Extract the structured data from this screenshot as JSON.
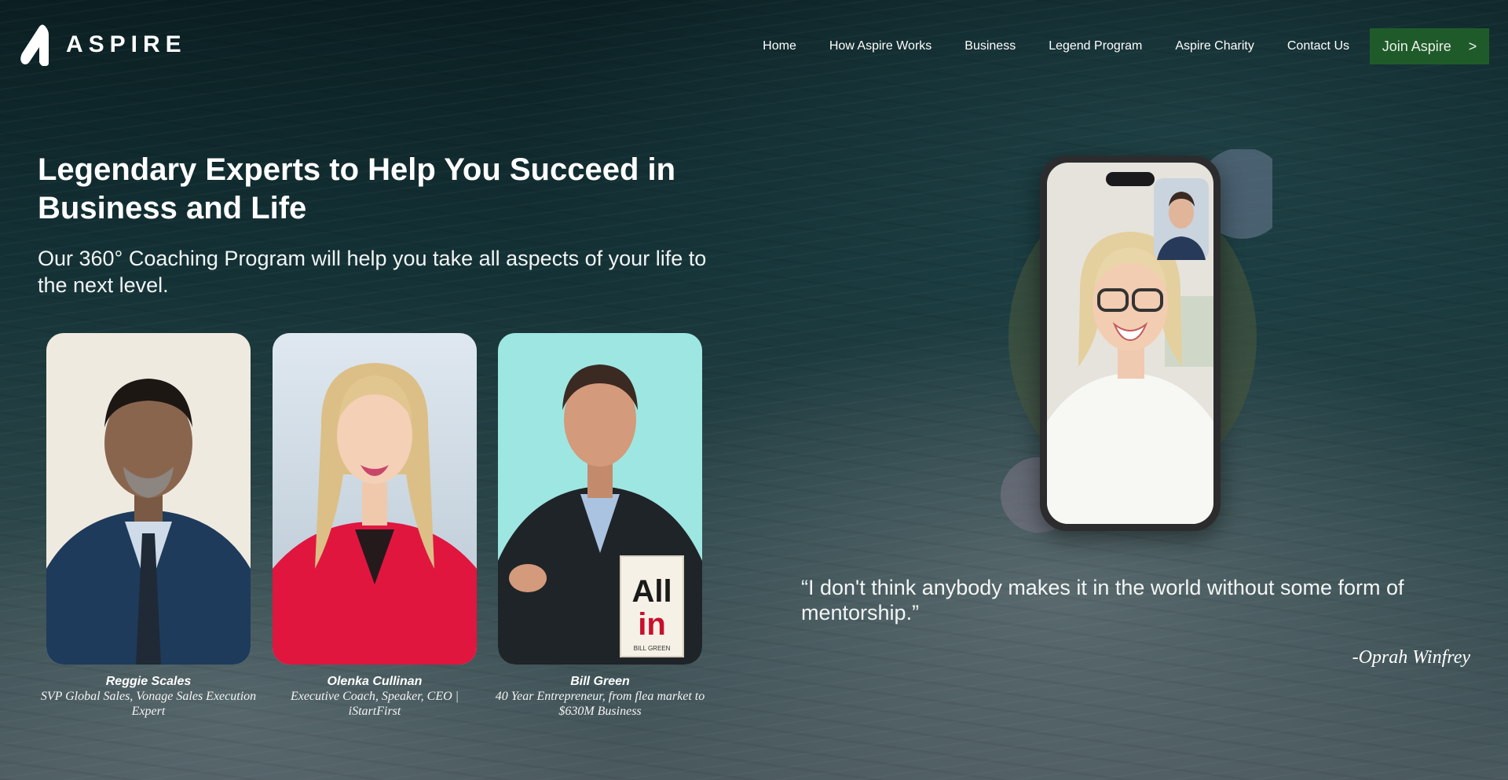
{
  "header": {
    "logo_text": "ASPIRE",
    "nav": [
      "Home",
      "How Aspire Works",
      "Business",
      "Legend Program",
      "Aspire Charity",
      "Contact Us"
    ],
    "cta_label": "Join Aspire",
    "cta_arrow": ">"
  },
  "hero": {
    "title": "Legendary Experts to Help You Succeed in Business and Life",
    "subtitle": "Our 360° Coaching Program will help you take all aspects of your life to the next level."
  },
  "experts": [
    {
      "name": "Reggie Scales",
      "role": "SVP Global Sales, Vonage Sales Execution Expert"
    },
    {
      "name": "Olenka Cullinan",
      "role": "Executive Coach, Speaker, CEO | iStartFirst"
    },
    {
      "name": "Bill Green",
      "role": "40 Year Entrepreneur, from flea market to $630M Business"
    }
  ],
  "book": {
    "line1": "All",
    "line2": "in",
    "author": "BILL GREEN"
  },
  "quote": {
    "text": "“I don't think anybody makes it in the world without some form of mentorship.”",
    "author": "-Oprah Winfrey"
  },
  "colors": {
    "cta": "#1f5b2a",
    "background": "#143236"
  },
  "icons": {
    "logo": "aspire-a-mark-icon",
    "cta_arrow": "chevron-right-icon"
  }
}
